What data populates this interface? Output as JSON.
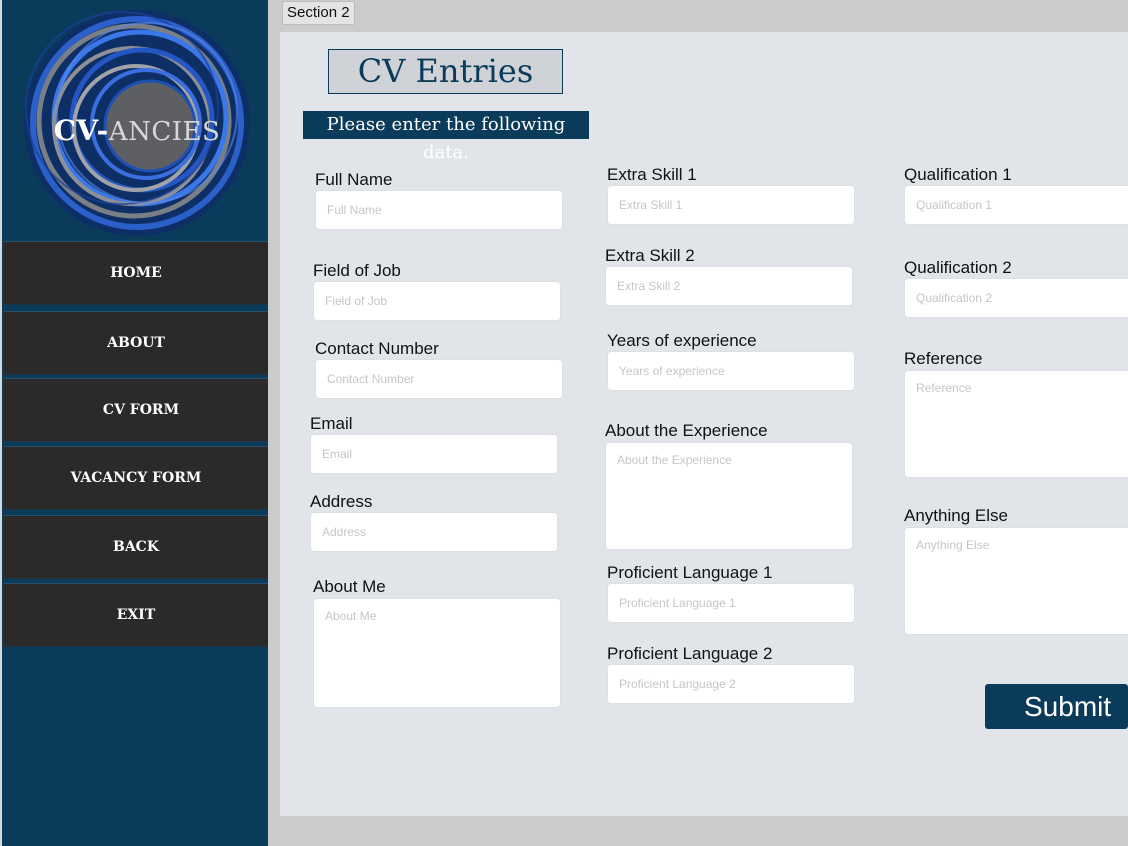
{
  "logo": {
    "text_part1": "CV-",
    "text_part2": "ANCIES"
  },
  "nav": [
    "HOME",
    "ABOUT",
    "CV  FORM",
    "VACANCY FORM",
    "BACK",
    "EXIT"
  ],
  "section_tab": "Section 2",
  "page": {
    "title": "CV Entries",
    "subtitle": "Please enter the following data."
  },
  "fields": {
    "full_name": {
      "label": "Full Name",
      "placeholder": "Full Name"
    },
    "field_of_job": {
      "label": "Field of Job",
      "placeholder": "Field of Job"
    },
    "contact_number": {
      "label": "Contact Number",
      "placeholder": "Contact Number"
    },
    "email": {
      "label": "Email",
      "placeholder": "Email"
    },
    "address": {
      "label": "Address",
      "placeholder": "Address"
    },
    "about_me": {
      "label": "About Me",
      "placeholder": "About Me"
    },
    "extra_skill_1": {
      "label": "Extra Skill 1",
      "placeholder": "Extra Skill 1"
    },
    "extra_skill_2": {
      "label": "Extra Skill 2",
      "placeholder": "Extra Skill 2"
    },
    "years_of_experience": {
      "label": "Years of experience",
      "placeholder": "Years of experience"
    },
    "about_experience": {
      "label": "About the Experience",
      "placeholder": "About the Experience"
    },
    "proficient_language_1": {
      "label": "Proficient Language 1",
      "placeholder": "Proficient Language 1"
    },
    "proficient_language_2": {
      "label": "Proficient Language 2",
      "placeholder": "Proficient Language 2"
    },
    "qualification_1": {
      "label": "Qualification 1",
      "placeholder": "Qualification 1"
    },
    "qualification_2": {
      "label": "Qualification 2",
      "placeholder": "Qualification 2"
    },
    "reference": {
      "label": "Reference",
      "placeholder": "Reference"
    },
    "anything_else": {
      "label": "Anything Else",
      "placeholder": "Anything Else"
    }
  },
  "submit_label": "Submit",
  "colors": {
    "brand_navy": "#0b3b5b",
    "nav_button": "#2b2a29",
    "panel_bg": "#e1e4e8",
    "logo_ring_blue": "#1f5fd6"
  }
}
